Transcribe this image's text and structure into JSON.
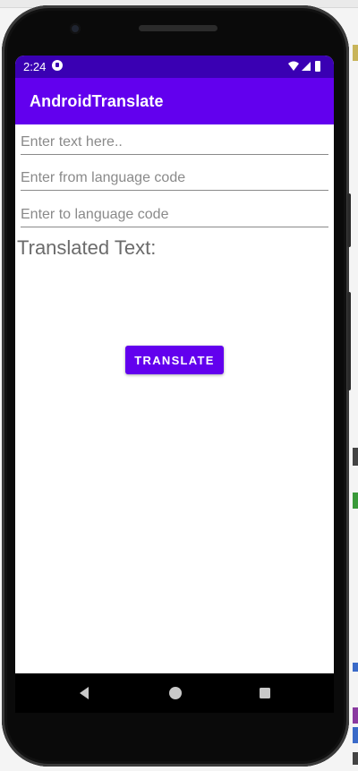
{
  "status_bar": {
    "time": "2:24"
  },
  "app_bar": {
    "title": "AndroidTranslate"
  },
  "form": {
    "text_field": {
      "placeholder": "Enter text here..",
      "value": ""
    },
    "from_field": {
      "placeholder": "Enter from language code",
      "value": ""
    },
    "to_field": {
      "placeholder": "Enter to language code",
      "value": ""
    }
  },
  "output": {
    "label": "Translated Text:"
  },
  "actions": {
    "translate_label": "TRANSLATE"
  },
  "colors": {
    "status_bar": "#3a00b3",
    "primary": "#6200ee",
    "phone_frame": "#0a0a0a"
  },
  "icons": {
    "status": [
      "notification-icon",
      "wifi-icon",
      "signal-icon",
      "battery-icon"
    ],
    "nav": [
      "back-icon",
      "home-icon",
      "recents-icon"
    ]
  }
}
